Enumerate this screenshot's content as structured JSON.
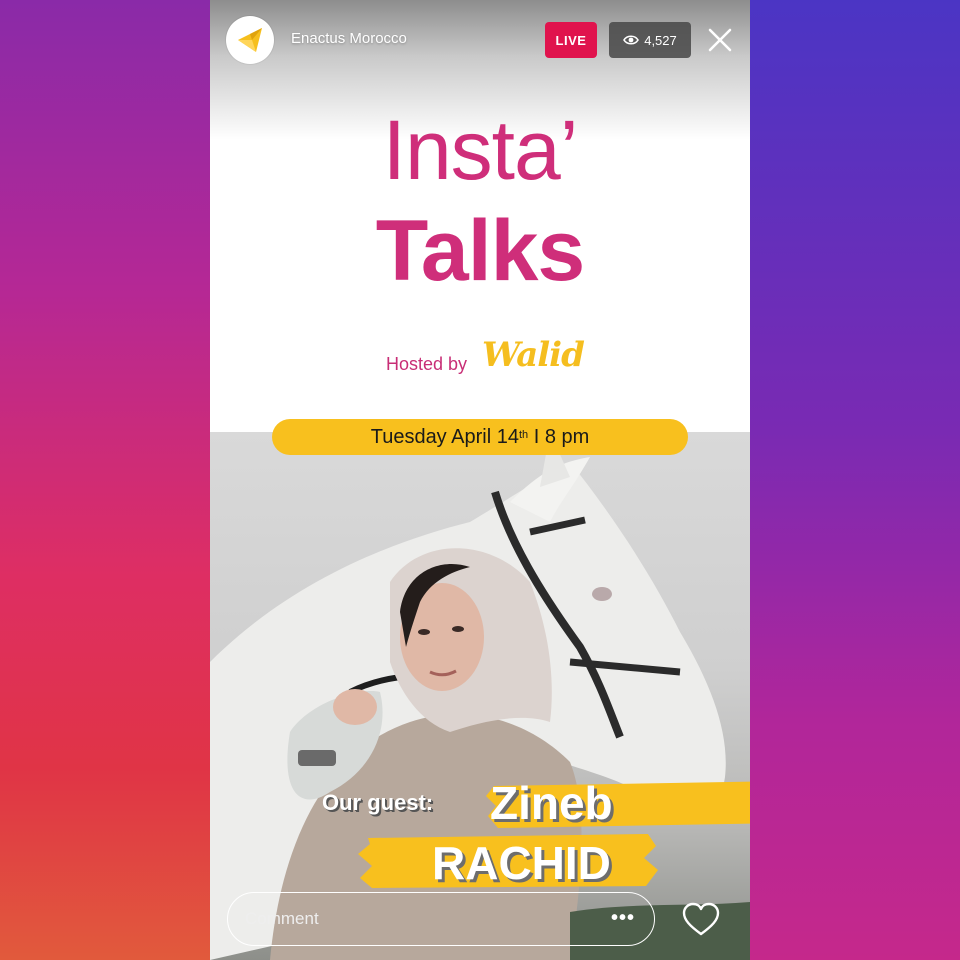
{
  "header": {
    "account_name": "Enactus Morocco",
    "live_label": "LIVE",
    "viewer_count": "4,527"
  },
  "poster": {
    "title_line1": "Insta’",
    "title_line2": "Talks",
    "hosted_by": "Hosted by",
    "host_name": "Walid",
    "date_main": "Tuesday April 14",
    "date_suffix": "th",
    "date_time": "I 8 pm",
    "guest_label": "Our guest:",
    "guest_first": "Zineb",
    "guest_last": "RACHID"
  },
  "comment": {
    "placeholder": "Comment",
    "more_label": "•••"
  },
  "colors": {
    "accent_pink": "#cf2e7a",
    "accent_yellow": "#f8c01e",
    "live_red": "#e0134d"
  },
  "icons": [
    "enactus-logo-icon",
    "eye-icon",
    "close-icon",
    "more-icon",
    "heart-icon"
  ]
}
